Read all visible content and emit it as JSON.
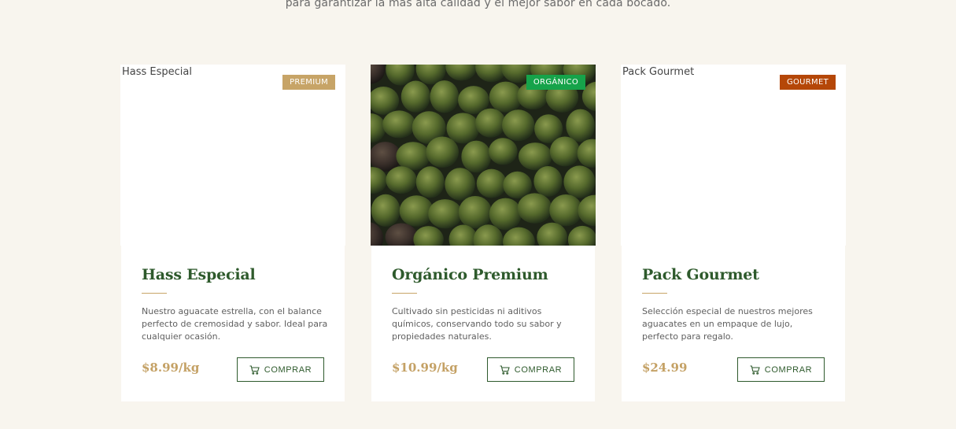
{
  "intro": {
    "text": "para garantizar la más alta calidad y el mejor sabor en cada bocado."
  },
  "products": [
    {
      "image_alt": "Hass Especial",
      "badge": "PREMIUM",
      "badge_color": "#c7a467",
      "title": "Hass Especial",
      "description": "Nuestro aguacate estrella, con el balance perfecto de cremosidad y sabor. Ideal para cualquier ocasión.",
      "price": "$8.99/kg",
      "button": "COMPRAR"
    },
    {
      "image_alt": "",
      "badge": "ORGÁNICO",
      "badge_color": "#16a34a",
      "title": "Orgánico Premium",
      "description": "Cultivado sin pesticidas ni aditivos químicos, conservando todo su sabor y propiedades naturales.",
      "price": "$10.99/kg",
      "button": "COMPRAR"
    },
    {
      "image_alt": "Pack Gourmet",
      "badge": "GOURMET",
      "badge_color": "#b54708",
      "title": "Pack Gourmet",
      "description": "Selección especial de nuestros mejores aguacates en un empaque de lujo, perfecto para regalo.",
      "price": "$24.99",
      "button": "COMPRAR"
    }
  ],
  "icons": {
    "cart": "shopping-cart-icon"
  }
}
